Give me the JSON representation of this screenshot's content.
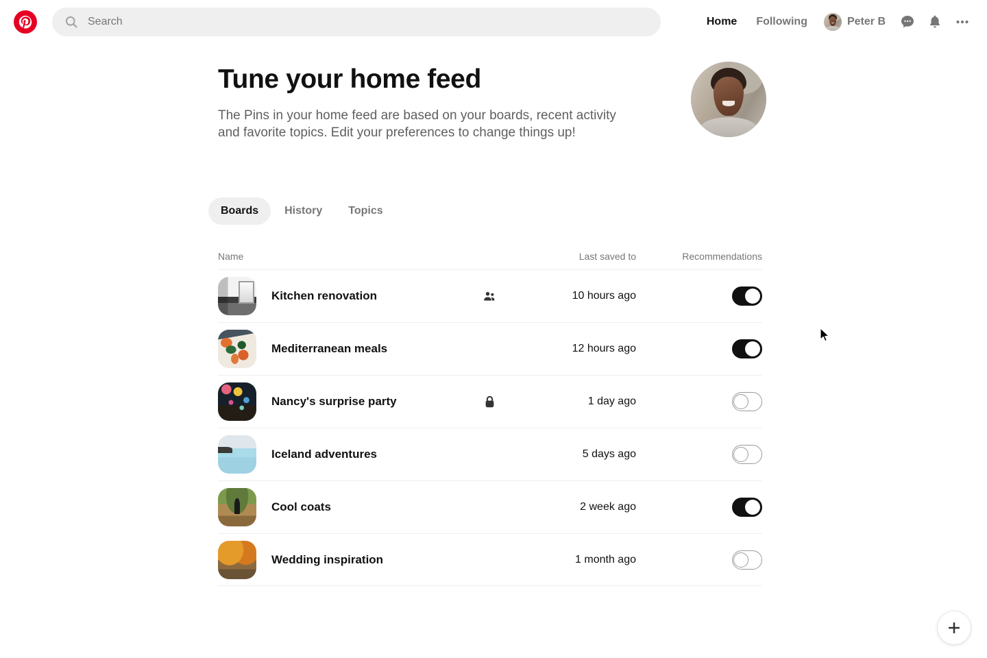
{
  "header": {
    "logo_icon": "pinterest-logo-icon",
    "search": {
      "icon": "search-icon",
      "placeholder": "Search",
      "value": ""
    },
    "nav": [
      {
        "label": "Home",
        "active": true
      },
      {
        "label": "Following",
        "active": false
      }
    ],
    "user": {
      "name": "Peter B",
      "avatar_icon": "user-avatar"
    },
    "actions": [
      {
        "icon": "messages-icon",
        "label": "Messages"
      },
      {
        "icon": "notifications-bell-icon",
        "label": "Notifications"
      },
      {
        "icon": "more-options-icon",
        "label": "More options"
      }
    ]
  },
  "hero": {
    "title": "Tune your home feed",
    "description": "The Pins in your home feed are based on your boards, recent activity and favorite topics. Edit your preferences to change things up!",
    "avatar_icon": "profile-photo"
  },
  "tabs": [
    {
      "label": "Boards",
      "active": true
    },
    {
      "label": "History",
      "active": false
    },
    {
      "label": "Topics",
      "active": false
    }
  ],
  "table": {
    "columns": {
      "name": "Name",
      "last_saved": "Last saved to",
      "recommendations": "Recommendations"
    },
    "rows": [
      {
        "name": "Kitchen renovation",
        "badge": "collaborators-icon",
        "last_saved": "10 hours ago",
        "recommendations_on": true,
        "thumb": "art-kitchen"
      },
      {
        "name": "Mediterranean meals",
        "badge": "",
        "last_saved": "12 hours ago",
        "recommendations_on": true,
        "thumb": "art-meals"
      },
      {
        "name": "Nancy's surprise party",
        "badge": "lock-icon",
        "last_saved": "1 day ago",
        "recommendations_on": false,
        "thumb": "art-party"
      },
      {
        "name": "Iceland adventures",
        "badge": "",
        "last_saved": "5 days ago",
        "recommendations_on": false,
        "thumb": "art-iceland"
      },
      {
        "name": "Cool coats",
        "badge": "",
        "last_saved": "2 week ago",
        "recommendations_on": true,
        "thumb": "art-coats"
      },
      {
        "name": "Wedding inspiration",
        "badge": "",
        "last_saved": "1 month ago",
        "recommendations_on": false,
        "thumb": "art-wedding"
      }
    ]
  },
  "fab": {
    "icon": "plus-icon",
    "label": "Create"
  },
  "colors": {
    "brand_red": "#e60023",
    "text_primary": "#111111",
    "text_secondary": "#767676",
    "surface_muted": "#efefef",
    "toggle_on": "#111111",
    "toggle_off_border": "#9a9a9a",
    "divider": "#eeeeee"
  }
}
